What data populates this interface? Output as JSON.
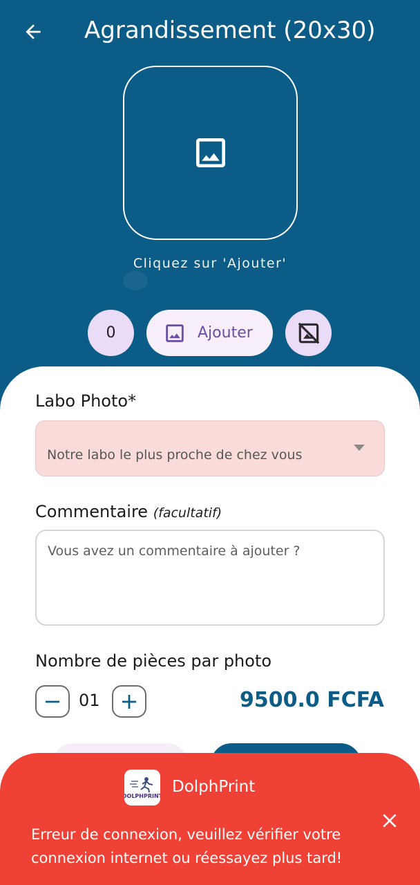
{
  "header": {
    "title": "Agrandissement (20x30)",
    "back_icon": "arrow-left-icon"
  },
  "upload": {
    "hint": "Cliquez sur 'Ajouter'",
    "placeholder_icon": "image-icon"
  },
  "actions": {
    "count": "0",
    "add_label": "Ajouter",
    "add_icon": "image-icon",
    "clear_icon": "image-off-icon"
  },
  "form": {
    "lab_label": "Labo Photo*",
    "lab_placeholder": "Notre labo le plus proche de chez vous",
    "comment_label": "Commentaire",
    "comment_optional": "(facultatif)",
    "comment_placeholder": "Vous avez un commentaire à ajouter ?",
    "pieces_label": "Nombre de pièces par photo",
    "quantity": "01",
    "price": "9500.0 FCFA"
  },
  "toast": {
    "app_name": "DolphPrint",
    "logo_text": "DOLPHPRINT",
    "message": "Erreur de connexion, veuillez vérifier votre connexion internet ou réessayez plus tard!"
  },
  "colors": {
    "primary": "#0b5c87",
    "accent": "#6a4fa3",
    "error": "#ef4136",
    "chip": "#eadcf9",
    "select_error_bg": "#f9dcda"
  }
}
